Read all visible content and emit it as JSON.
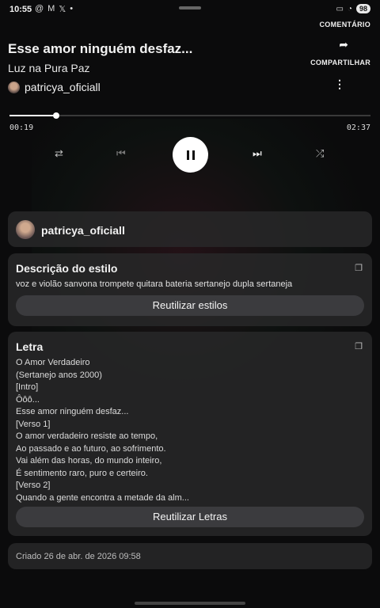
{
  "status_bar": {
    "time": "10:55",
    "left_icons": [
      "threads-icon",
      "gmail-icon",
      "x-icon",
      "dot"
    ],
    "left_glyphs": [
      "@",
      "M",
      "𝕏",
      "•"
    ],
    "battery": "98"
  },
  "song": {
    "title": "Esse amor ninguém desfaz...",
    "artist_tag": "Luz na Pura Paz",
    "creator": "patricya_oficiall"
  },
  "actions": {
    "comment_label": "COMENTÁRIO",
    "share_label": "COMPARTILHAR"
  },
  "player": {
    "elapsed": "00:19",
    "total": "02:37",
    "progress_fraction": 0.13
  },
  "user_card": {
    "username": "patricya_oficiall"
  },
  "style_card": {
    "title": "Descrição do estilo",
    "text": "voz e violão sanvona trompete quitara bateria sertanejo dupla sertaneja",
    "button_label": "Reutilizar estilos"
  },
  "lyrics_card": {
    "title": "Letra",
    "lines": [
      "O Amor Verdadeiro",
      "(Sertanejo anos 2000)",
      "[Intro]",
      "Ôôô...",
      "Esse amor ninguém desfaz...",
      "[Verso 1]",
      "O amor verdadeiro resiste ao tempo,",
      "Ao passado e ao futuro, ao sofrimento.",
      "Vai além das horas, do mundo inteiro,",
      "É sentimento raro, puro e certeiro.",
      "[Verso 2]",
      "Quando a gente encontra a metade da alm..."
    ],
    "button_label": "Reutilizar Letras"
  },
  "created": {
    "text": "Criado 26 de abr. de 2026 09:58"
  },
  "colors": {
    "background": "#0b0b0c",
    "card": "#28282a",
    "button": "#3b3b3e",
    "accent": "#ffffff"
  }
}
